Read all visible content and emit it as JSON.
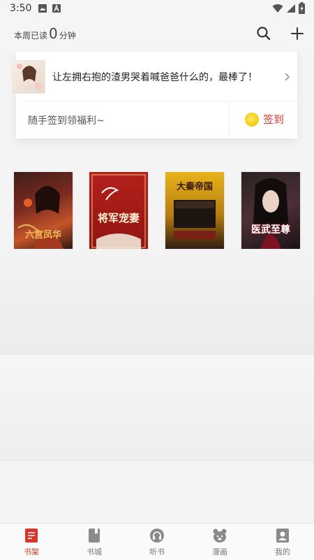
{
  "status_bar": {
    "time": "3:50",
    "icons": [
      "image-icon",
      "text-a-icon",
      "wifi-icon",
      "signal-icon",
      "battery-charging-icon"
    ]
  },
  "header": {
    "reading_prefix": "本周已读",
    "reading_minutes": "0",
    "reading_suffix": "分钟",
    "search_icon": "search-icon",
    "add_icon": "plus-icon"
  },
  "card": {
    "notice_text": "让左拥右抱的渣男哭着喊爸爸什么的，最棒了！",
    "promo_text": "随手签到领福利~",
    "checkin_label": "签到",
    "accent_color": "#d9362b"
  },
  "books": [
    {
      "title": "六宫凤华"
    },
    {
      "title": "将军宠妻"
    },
    {
      "title": "大秦帝国"
    },
    {
      "title": "医武至尊"
    }
  ],
  "tabs": [
    {
      "label": "书架",
      "icon": "bookshelf-icon",
      "active": true
    },
    {
      "label": "书城",
      "icon": "bookstore-icon",
      "active": false
    },
    {
      "label": "听书",
      "icon": "headphones-icon",
      "active": false
    },
    {
      "label": "漫画",
      "icon": "bear-icon",
      "active": false
    },
    {
      "label": "我的",
      "icon": "profile-icon",
      "active": false
    }
  ]
}
